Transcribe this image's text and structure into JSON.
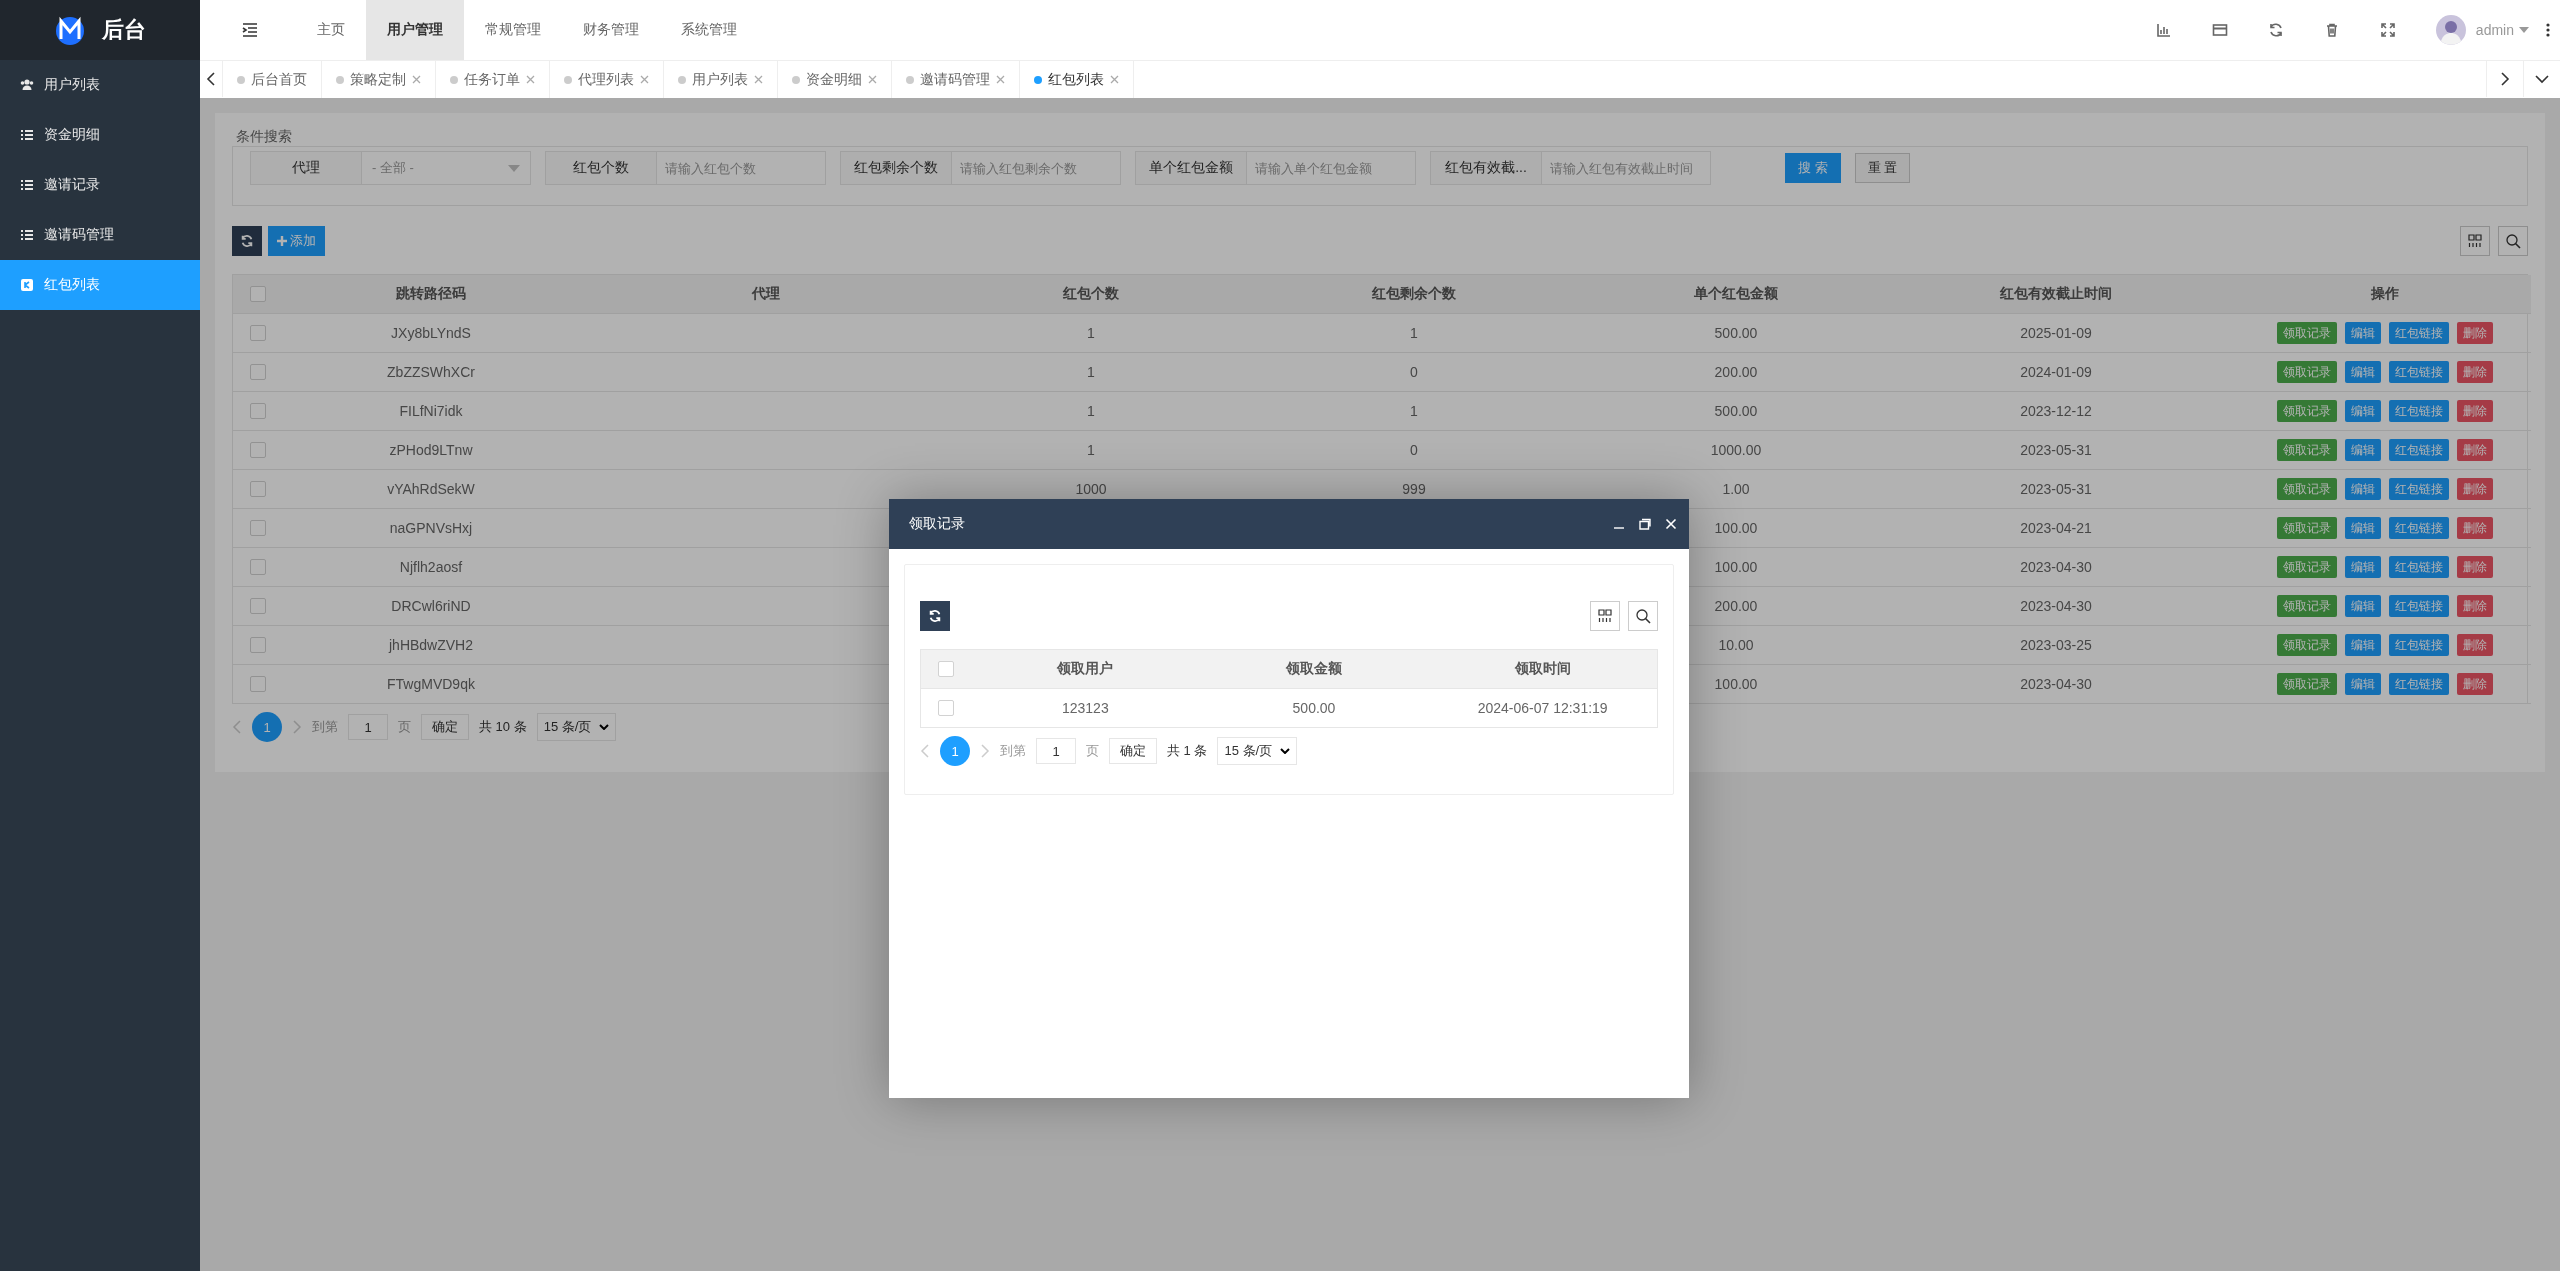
{
  "brand": {
    "title": "后台"
  },
  "sidebar": {
    "items": [
      {
        "label": "用户列表",
        "selected": false
      },
      {
        "label": "资金明细",
        "selected": false
      },
      {
        "label": "邀请记录",
        "selected": false
      },
      {
        "label": "邀请码管理",
        "selected": false
      },
      {
        "label": "红包列表",
        "selected": true
      }
    ]
  },
  "top_nav": [
    {
      "label": "主页",
      "selected": false
    },
    {
      "label": "用户管理",
      "selected": true
    },
    {
      "label": "常规管理",
      "selected": false
    },
    {
      "label": "财务管理",
      "selected": false
    },
    {
      "label": "系统管理",
      "selected": false
    }
  ],
  "user": {
    "name": "admin"
  },
  "tabs": [
    {
      "label": "后台首页",
      "selected": false,
      "closable": false
    },
    {
      "label": "策略定制",
      "selected": false,
      "closable": true
    },
    {
      "label": "任务订单",
      "selected": false,
      "closable": true
    },
    {
      "label": "代理列表",
      "selected": false,
      "closable": true
    },
    {
      "label": "用户列表",
      "selected": false,
      "closable": true
    },
    {
      "label": "资金明细",
      "selected": false,
      "closable": true
    },
    {
      "label": "邀请码管理",
      "selected": false,
      "closable": true
    },
    {
      "label": "红包列表",
      "selected": true,
      "closable": true
    }
  ],
  "search": {
    "legend": "条件搜索",
    "fields": [
      {
        "label": "代理",
        "kind": "select",
        "value": "- 全部 -"
      },
      {
        "label": "红包个数",
        "kind": "input",
        "placeholder": "请输入红包个数"
      },
      {
        "label": "红包剩余个数",
        "kind": "input",
        "placeholder": "请输入红包剩余个数"
      },
      {
        "label": "单个红包金额",
        "kind": "input",
        "placeholder": "请输入单个红包金额"
      },
      {
        "label": "红包有效截...",
        "kind": "input",
        "placeholder": "请输入红包有效截止时间"
      }
    ],
    "buttons": [
      {
        "label": "搜 索",
        "kind": "primary"
      },
      {
        "label": "重 置",
        "kind": "plain"
      }
    ]
  },
  "toolbar": {
    "add_label": "添加"
  },
  "table": {
    "all_checked": false,
    "columns": [
      "跳转路径码",
      "代理",
      "红包个数",
      "红包剩余个数",
      "单个红包金额",
      "红包有效截止时间",
      "操作"
    ],
    "rows": [
      {
        "checked": false,
        "path": "JXy8bLYndS",
        "count": "1",
        "remaining": "1",
        "amount": "500.00",
        "deadline": "2025-01-09",
        "actions": [
          {
            "label": "领取记录",
            "kind": "records"
          },
          {
            "label": "编辑",
            "kind": "edit"
          },
          {
            "label": "红包链接",
            "kind": "link"
          },
          {
            "label": "删除",
            "kind": "delete"
          }
        ]
      },
      {
        "checked": false,
        "path": "ZbZZSWhXCr",
        "count": "1",
        "remaining": "0",
        "amount": "200.00",
        "deadline": "2024-01-09",
        "actions": [
          {
            "label": "领取记录",
            "kind": "records"
          },
          {
            "label": "编辑",
            "kind": "edit"
          },
          {
            "label": "红包链接",
            "kind": "link"
          },
          {
            "label": "删除",
            "kind": "delete"
          }
        ]
      },
      {
        "checked": false,
        "path": "FILfNi7idk",
        "count": "1",
        "remaining": "1",
        "amount": "500.00",
        "deadline": "2023-12-12",
        "actions": [
          {
            "label": "领取记录",
            "kind": "records"
          },
          {
            "label": "编辑",
            "kind": "edit"
          },
          {
            "label": "红包链接",
            "kind": "link"
          },
          {
            "label": "删除",
            "kind": "delete"
          }
        ]
      },
      {
        "checked": false,
        "path": "zPHod9LTnw",
        "count": "1",
        "remaining": "0",
        "amount": "1000.00",
        "deadline": "2023-05-31",
        "actions": [
          {
            "label": "领取记录",
            "kind": "records"
          },
          {
            "label": "编辑",
            "kind": "edit"
          },
          {
            "label": "红包链接",
            "kind": "link"
          },
          {
            "label": "删除",
            "kind": "delete"
          }
        ]
      },
      {
        "checked": false,
        "path": "vYAhRdSekW",
        "count": "1000",
        "remaining": "999",
        "amount": "1.00",
        "deadline": "2023-05-31",
        "actions": [
          {
            "label": "领取记录",
            "kind": "records"
          },
          {
            "label": "编辑",
            "kind": "edit"
          },
          {
            "label": "红包链接",
            "kind": "link"
          },
          {
            "label": "删除",
            "kind": "delete"
          }
        ]
      },
      {
        "checked": false,
        "path": "naGPNVsHxj",
        "amount": "100.00",
        "deadline": "2023-04-21",
        "actions": [
          {
            "label": "领取记录",
            "kind": "records"
          },
          {
            "label": "编辑",
            "kind": "edit"
          },
          {
            "label": "红包链接",
            "kind": "link"
          },
          {
            "label": "删除",
            "kind": "delete"
          }
        ]
      },
      {
        "checked": false,
        "path": "Njflh2aosf",
        "amount": "100.00",
        "deadline": "2023-04-30",
        "actions": [
          {
            "label": "领取记录",
            "kind": "records"
          },
          {
            "label": "编辑",
            "kind": "edit"
          },
          {
            "label": "红包链接",
            "kind": "link"
          },
          {
            "label": "删除",
            "kind": "delete"
          }
        ]
      },
      {
        "checked": false,
        "path": "DRCwl6riND",
        "amount": "200.00",
        "deadline": "2023-04-30",
        "actions": [
          {
            "label": "领取记录",
            "kind": "records"
          },
          {
            "label": "编辑",
            "kind": "edit"
          },
          {
            "label": "红包链接",
            "kind": "link"
          },
          {
            "label": "删除",
            "kind": "delete"
          }
        ]
      },
      {
        "checked": false,
        "path": "jhHBdwZVH2",
        "amount": "10.00",
        "deadline": "2023-03-25",
        "actions": [
          {
            "label": "领取记录",
            "kind": "records"
          },
          {
            "label": "编辑",
            "kind": "edit"
          },
          {
            "label": "红包链接",
            "kind": "link"
          },
          {
            "label": "删除",
            "kind": "delete"
          }
        ]
      },
      {
        "checked": false,
        "path": "FTwgMVD9qk",
        "amount": "100.00",
        "deadline": "2023-04-30",
        "actions": [
          {
            "label": "领取记录",
            "kind": "records"
          },
          {
            "label": "编辑",
            "kind": "edit"
          },
          {
            "label": "红包链接",
            "kind": "link"
          },
          {
            "label": "删除",
            "kind": "delete"
          }
        ]
      }
    ]
  },
  "pagination": {
    "page": "1",
    "goto_label": "到第",
    "goto_value": "1",
    "page_unit": "页",
    "confirm": "确定",
    "total": "共 10 条",
    "page_size": "15 条/页"
  },
  "modal": {
    "title": "领取记录",
    "table": {
      "all_checked": false,
      "columns": [
        "领取用户",
        "领取金额",
        "领取时间"
      ],
      "rows": [
        {
          "checked": false,
          "cells": [
            "123123",
            "500.00",
            "2024-06-07 12:31:19"
          ]
        }
      ]
    },
    "pagination": {
      "page": "1",
      "goto_label": "到第",
      "goto_value": "1",
      "page_unit": "页",
      "confirm": "确定",
      "total": "共 1 条",
      "page_size": "15 条/页"
    }
  }
}
